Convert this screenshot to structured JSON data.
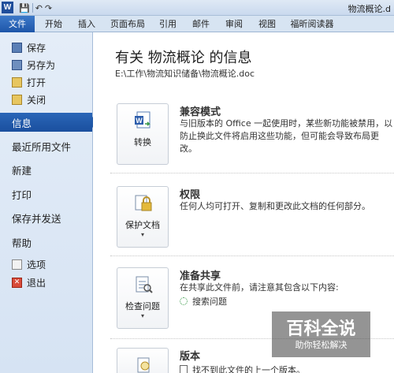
{
  "titlebar": {
    "logo": "W",
    "qat": [
      "💾",
      "↶",
      "↷"
    ],
    "doc_title": "物流概论.d"
  },
  "tabs": [
    "文件",
    "开始",
    "插入",
    "页面布局",
    "引用",
    "邮件",
    "审阅",
    "视图",
    "福昕阅读器"
  ],
  "nav": {
    "small_top": [
      "保存",
      "另存为",
      "打开",
      "关闭"
    ],
    "big": [
      "信息",
      "最近所用文件",
      "新建",
      "打印",
      "保存并发送",
      "帮助"
    ],
    "small_bottom": [
      "选项",
      "退出"
    ],
    "active": "信息"
  },
  "main": {
    "title": "有关 物流概论 的信息",
    "path": "E:\\工作\\物流知识储备\\物流概论.doc",
    "sections": [
      {
        "button_label": "转换",
        "title": "兼容模式",
        "desc": "与旧版本的 Office 一起使用时，某些新功能被禁用，以防止换此文件将启用这些功能，但可能会导致布局更改。",
        "icon": "word-convert-icon"
      },
      {
        "button_label": "保护文档",
        "title": "权限",
        "desc": "任何人均可打开、复制和更改此文档的任何部分。",
        "icon": "lock-icon"
      },
      {
        "button_label": "检查问题",
        "title": "准备共享",
        "desc": "在共享此文件前，请注意其包含以下内容:",
        "sub": "搜索问题",
        "icon": "checklist-icon"
      },
      {
        "button_label": "",
        "title": "版本",
        "desc": "",
        "sub": "找不到此文件的上一个版本。",
        "icon": "versions-icon"
      }
    ]
  },
  "watermark": {
    "title": "百科全说",
    "sub": "助你轻松解决"
  },
  "colors": {
    "file_tab": "#1e56a9",
    "nav_active": "#1f57a5",
    "nav_bg": "#dfe9f6"
  }
}
